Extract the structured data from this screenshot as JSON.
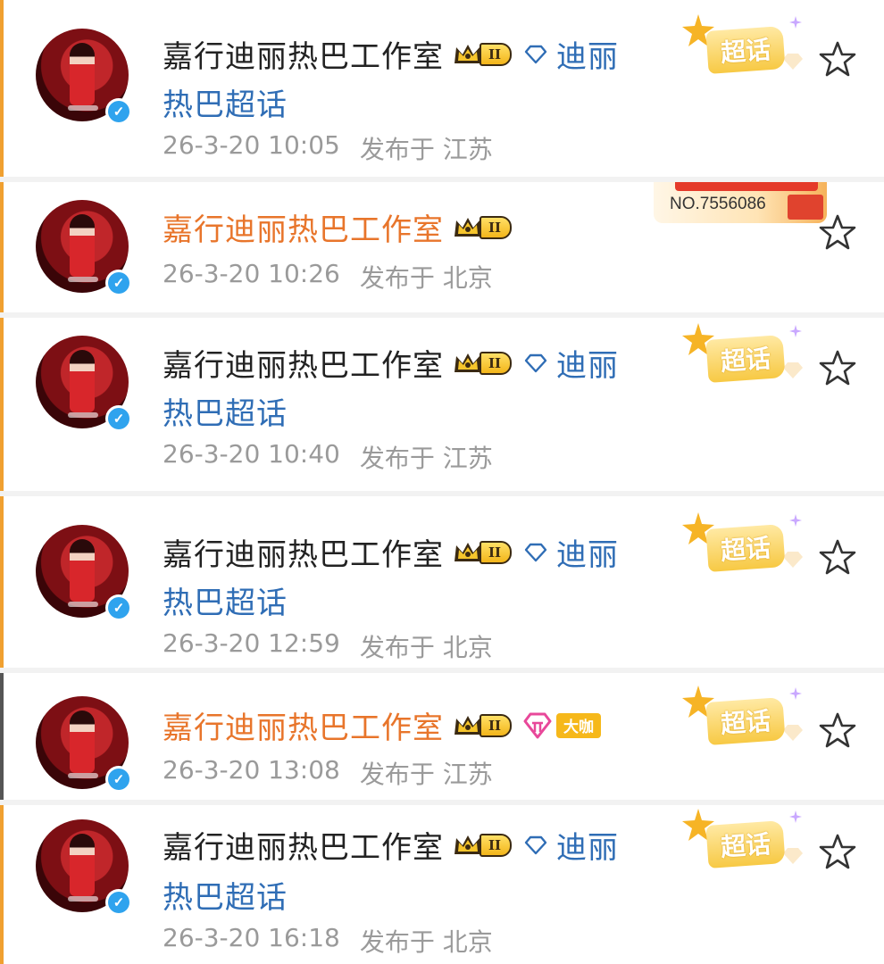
{
  "colors": {
    "name_default": "#222222",
    "name_highlight": "#e8752b",
    "topic_link": "#2f6db5",
    "meta_gray": "#9a9a9a",
    "verified_blue": "#2fa3ee",
    "badge_gold": "#f7c944"
  },
  "icons": {
    "verified": "verified-icon",
    "crown": "crown-icon",
    "topic_gem": "diamond-outline-icon",
    "chaohua": "super-topic-badge",
    "favorite": "star-outline-icon",
    "fan_gem": "pink-gem-icon"
  },
  "posts": [
    {
      "name": "嘉行迪丽热巴工作室",
      "name_highlight": false,
      "level": "II",
      "topic_line1": "迪丽",
      "topic_line2": "热巴超话",
      "date": "26-3-20 10:05",
      "location": "发布于 江苏",
      "super_topic": "超话"
    },
    {
      "name": "嘉行迪丽热巴工作室",
      "name_highlight": true,
      "level": "II",
      "date": "26-3-20 10:26",
      "location": "发布于 北京",
      "badge_no": "NO.7556086"
    },
    {
      "name": "嘉行迪丽热巴工作室",
      "name_highlight": false,
      "level": "II",
      "topic_line1": "迪丽",
      "topic_line2": "热巴超话",
      "date": "26-3-20 10:40",
      "location": "发布于 江苏",
      "super_topic": "超话"
    },
    {
      "name": "嘉行迪丽热巴工作室",
      "name_highlight": false,
      "level": "II",
      "topic_line1": "迪丽",
      "topic_line2": "热巴超话",
      "date": "26-3-20 12:59",
      "location": "发布于 北京",
      "super_topic": "超话"
    },
    {
      "name": "嘉行迪丽热巴工作室",
      "name_highlight": true,
      "level": "II",
      "fan_tag": "大咖",
      "date": "26-3-20 13:08",
      "location": "发布于 江苏",
      "super_topic": "超话"
    },
    {
      "name": "嘉行迪丽热巴工作室",
      "name_highlight": false,
      "level": "II",
      "topic_line1": "迪丽",
      "topic_line2": "热巴超话",
      "date": "26-3-20 16:18",
      "location": "发布于 北京",
      "super_topic": "超话"
    }
  ]
}
